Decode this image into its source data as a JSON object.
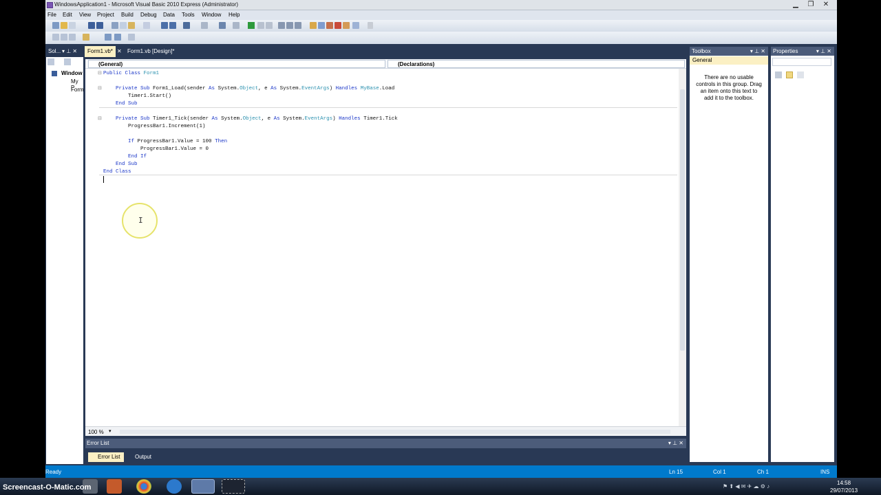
{
  "window": {
    "title": "WindowsApplication1 - Microsoft Visual Basic 2010 Express (Administrator)",
    "min": "▁",
    "max": "❐",
    "close": "✕"
  },
  "menu": [
    "File",
    "Edit",
    "View",
    "Project",
    "Build",
    "Debug",
    "Data",
    "Tools",
    "Window",
    "Help"
  ],
  "tabs": {
    "sol": "Sol...",
    "code": "Form1.vb*",
    "design": "Form1.vb [Design]*"
  },
  "solution": {
    "items": [
      "Window",
      "My P",
      "Form"
    ]
  },
  "editor": {
    "dropdown_left": "(General)",
    "dropdown_right": "(Declarations)",
    "zoom": "100 %",
    "lines": [
      [
        [
          "kw",
          "Public Class "
        ],
        [
          "ty",
          "Form1"
        ]
      ],
      [],
      [
        [
          "",
          "    "
        ],
        [
          "kw",
          "Private Sub "
        ],
        [
          "",
          "Form1_Load(sender "
        ],
        [
          "kw",
          "As "
        ],
        [
          "",
          "System."
        ],
        [
          "ty",
          "Object"
        ],
        [
          "",
          ", e "
        ],
        [
          "kw",
          "As "
        ],
        [
          "",
          "System."
        ],
        [
          "ty",
          "EventArgs"
        ],
        [
          "",
          ") "
        ],
        [
          "kw",
          "Handles "
        ],
        [
          "ty",
          "MyBase"
        ],
        [
          "",
          ".Load"
        ]
      ],
      [
        [
          "",
          "        Timer1.Start()"
        ]
      ],
      [
        [
          "",
          "    "
        ],
        [
          "kw",
          "End Sub"
        ]
      ],
      [],
      [
        [
          "",
          "    "
        ],
        [
          "kw",
          "Private Sub "
        ],
        [
          "",
          "Timer1_Tick(sender "
        ],
        [
          "kw",
          "As "
        ],
        [
          "",
          "System."
        ],
        [
          "ty",
          "Object"
        ],
        [
          "",
          ", e "
        ],
        [
          "kw",
          "As "
        ],
        [
          "",
          "System."
        ],
        [
          "ty",
          "EventArgs"
        ],
        [
          "",
          ") "
        ],
        [
          "kw",
          "Handles "
        ],
        [
          "",
          "Timer1.Tick"
        ]
      ],
      [
        [
          "",
          "        ProgressBar1.Increment(1)"
        ]
      ],
      [],
      [
        [
          "",
          "        "
        ],
        [
          "kw",
          "If "
        ],
        [
          "",
          "ProgressBar1.Value = 100 "
        ],
        [
          "kw",
          "Then"
        ]
      ],
      [
        [
          "",
          "            ProgressBar1.Value = 0"
        ]
      ],
      [
        [
          "",
          "        "
        ],
        [
          "kw",
          "End If"
        ]
      ],
      [
        [
          "",
          "    "
        ],
        [
          "kw",
          "End Sub"
        ]
      ],
      [
        [
          "kw",
          "End Class"
        ]
      ]
    ]
  },
  "toolbox": {
    "title": "Toolbox",
    "group": "General",
    "message": "There are no usable controls in this group. Drag an item onto this text to add it to the toolbox."
  },
  "properties": {
    "title": "Properties"
  },
  "errorlist": {
    "title": "Error List",
    "tab_errors": "Error List",
    "tab_output": "Output"
  },
  "status": {
    "ready": "Ready",
    "ln": "Ln 15",
    "col": "Col 1",
    "ch": "Ch 1",
    "ins": "INS"
  },
  "taskbar": {
    "time": "14:58",
    "date": "29/07/2013"
  },
  "watermark": "Screencast-O-Matic.com"
}
